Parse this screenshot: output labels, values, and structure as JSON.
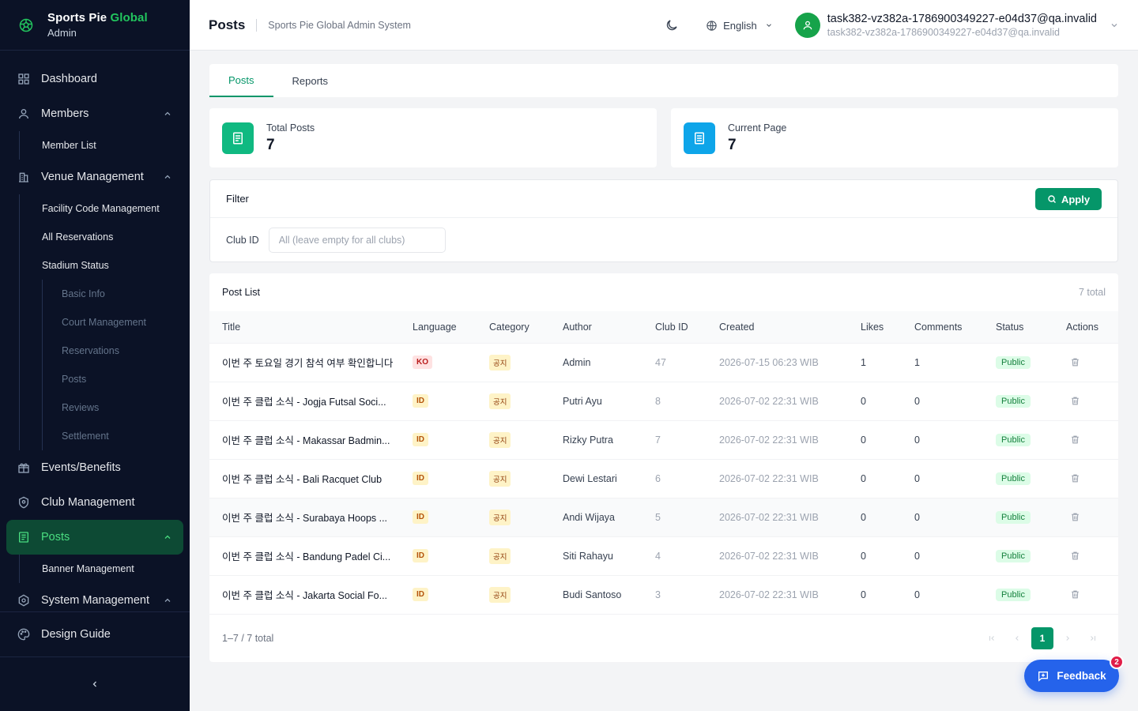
{
  "brand": {
    "name_main": "Sports Pie",
    "name_highlight": "Global",
    "subtitle": "Admin"
  },
  "sidebar": {
    "dashboard": "Dashboard",
    "members": {
      "label": "Members",
      "items": [
        "Member List"
      ]
    },
    "venue": {
      "label": "Venue Management",
      "items": [
        "Facility Code Management",
        "All Reservations",
        "Stadium Status"
      ],
      "stadium_items": [
        "Basic Info",
        "Court Management",
        "Reservations",
        "Posts",
        "Reviews",
        "Settlement"
      ]
    },
    "events": "Events/Benefits",
    "clubs": "Club Management",
    "posts": {
      "label": "Posts",
      "items": [
        "Banner Management"
      ]
    },
    "system": "System Management",
    "design_guide": "Design Guide"
  },
  "header": {
    "title": "Posts",
    "subtitle": "Sports Pie Global Admin System",
    "language": "English",
    "user_name": "task382-vz382a-1786900349227-e04d37@qa.invalid",
    "user_email": "task382-vz382a-1786900349227-e04d37@qa.invalid"
  },
  "tabs": [
    {
      "label": "Posts",
      "active": true
    },
    {
      "label": "Reports",
      "active": false
    }
  ],
  "stats": {
    "total_label": "Total Posts",
    "total_value": "7",
    "page_label": "Current Page",
    "page_value": "7"
  },
  "filter": {
    "title": "Filter",
    "apply_label": "Apply",
    "club_label": "Club ID",
    "club_placeholder": "All (leave empty for all clubs)",
    "club_value": ""
  },
  "post_list": {
    "title": "Post List",
    "total_text": "7 total",
    "columns": [
      "Title",
      "Language",
      "Category",
      "Author",
      "Club ID",
      "Created",
      "Likes",
      "Comments",
      "Status",
      "Actions"
    ],
    "rows": [
      {
        "title": "이번 주 토요일 경기 참석 여부 확인합니다",
        "language": "KO",
        "category": "공지",
        "author": "Admin",
        "club_id": "47",
        "created": "2026-07-15 06:23 WIB",
        "likes": "1",
        "comments": "1",
        "status": "Public"
      },
      {
        "title": "이번 주 클럽 소식 - Jogja Futsal Soci...",
        "language": "ID",
        "category": "공지",
        "author": "Putri Ayu",
        "club_id": "8",
        "created": "2026-07-02 22:31 WIB",
        "likes": "0",
        "comments": "0",
        "status": "Public"
      },
      {
        "title": "이번 주 클럽 소식 - Makassar Badmin...",
        "language": "ID",
        "category": "공지",
        "author": "Rizky Putra",
        "club_id": "7",
        "created": "2026-07-02 22:31 WIB",
        "likes": "0",
        "comments": "0",
        "status": "Public"
      },
      {
        "title": "이번 주 클럽 소식 - Bali Racquet Club",
        "language": "ID",
        "category": "공지",
        "author": "Dewi Lestari",
        "club_id": "6",
        "created": "2026-07-02 22:31 WIB",
        "likes": "0",
        "comments": "0",
        "status": "Public"
      },
      {
        "title": "이번 주 클럽 소식 - Surabaya Hoops ...",
        "language": "ID",
        "category": "공지",
        "author": "Andi Wijaya",
        "club_id": "5",
        "created": "2026-07-02 22:31 WIB",
        "likes": "0",
        "comments": "0",
        "status": "Public"
      },
      {
        "title": "이번 주 클럽 소식 - Bandung Padel Ci...",
        "language": "ID",
        "category": "공지",
        "author": "Siti Rahayu",
        "club_id": "4",
        "created": "2026-07-02 22:31 WIB",
        "likes": "0",
        "comments": "0",
        "status": "Public"
      },
      {
        "title": "이번 주 클럽 소식 - Jakarta Social Fo...",
        "language": "ID",
        "category": "공지",
        "author": "Budi Santoso",
        "club_id": "3",
        "created": "2026-07-02 22:31 WIB",
        "likes": "0",
        "comments": "0",
        "status": "Public"
      }
    ],
    "footer_info": "1–7 / 7 total",
    "current_page": "1"
  },
  "feedback": {
    "label": "Feedback",
    "count": "2"
  },
  "colors": {
    "accent": "#059669",
    "sidebar_bg": "#0b1226",
    "stat_green": "#10b981",
    "stat_blue": "#0ea5e9",
    "feedback": "#2563eb"
  }
}
